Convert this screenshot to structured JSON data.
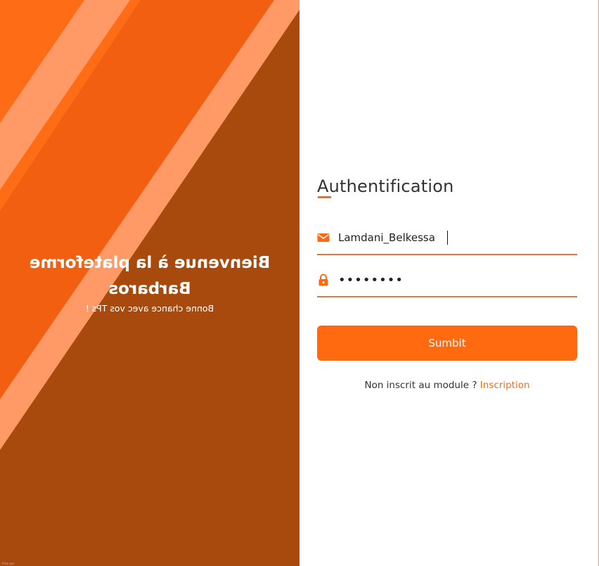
{
  "hero": {
    "title": "Bienvenue à la plateforme Barbaros",
    "subtitle": "Bonne chance avec vos TPs !",
    "credit": "top art.fr"
  },
  "auth": {
    "title": "Authentification",
    "email": {
      "icon": "envelope-icon",
      "value": "Lamdani_Belkessa"
    },
    "password": {
      "icon": "lock-icon",
      "value": "••••••••"
    },
    "submit_label": "Sumbit",
    "register_prompt": "Non inscrit au module ?",
    "register_link": "Inscription"
  },
  "colors": {
    "accent": "#ff6a10",
    "hero_dark": "#a84a0e",
    "hero_bright": "#ff6a14",
    "stripe": "#ff9a66",
    "underline": "#e07a3c"
  }
}
